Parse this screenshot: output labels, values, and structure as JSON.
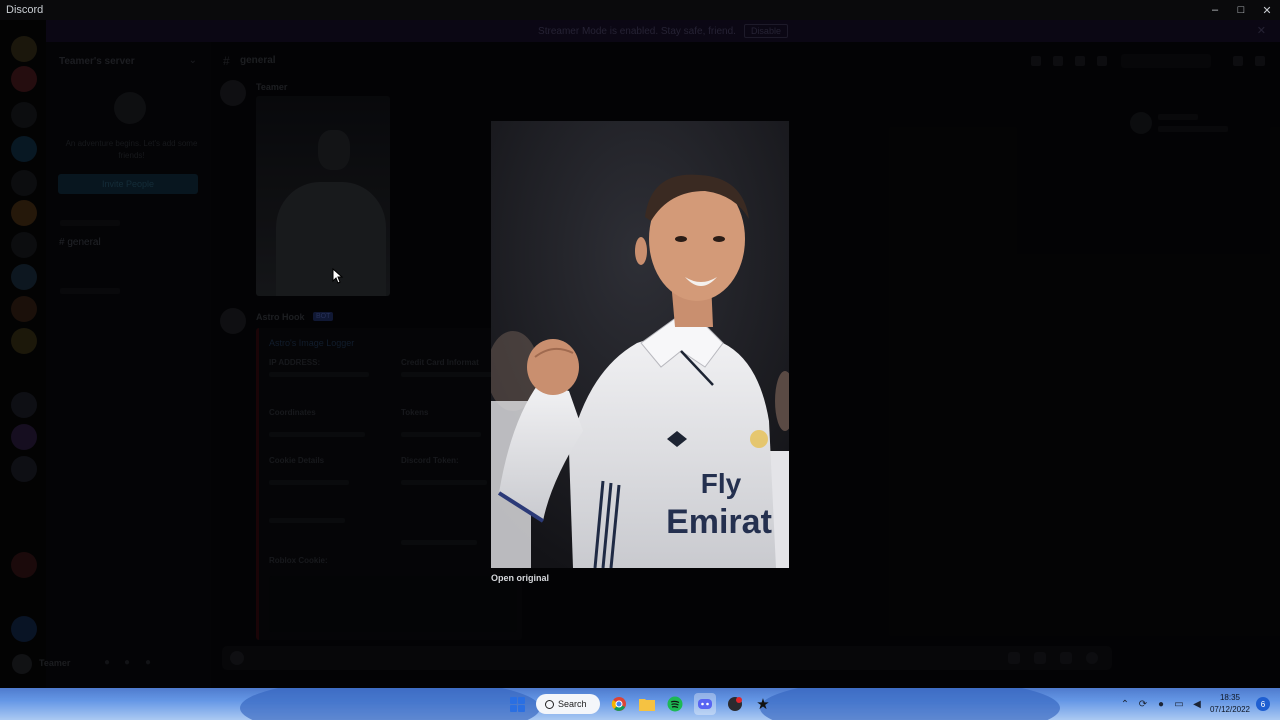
{
  "window": {
    "app_title": "Discord",
    "minimize": "–",
    "maximize": "□",
    "close": "✕"
  },
  "notice": {
    "text": "Streamer Mode is enabled. Stay safe, friend.",
    "button": "Disable"
  },
  "server": {
    "name": "Teamer's server",
    "invite_text": "An adventure begins. Let's add some friends!",
    "invite_button": "Invite People"
  },
  "channels": [
    {
      "name": "general"
    }
  ],
  "chat": {
    "channel_title": "general",
    "messages": [
      {
        "author": "Teamer",
        "has_image": true
      },
      {
        "author": "Astro Hook",
        "bot_tag": "BOT",
        "embed_title": "Astro's Image Logger"
      }
    ],
    "embed_fields": [
      "IP ADDRESS:",
      "Credit Card Informat",
      "Coordinates",
      "Tokens",
      "Cookie Details",
      "Discord Token:",
      "Roblox Cookie:"
    ]
  },
  "user": {
    "name": "Teamer"
  },
  "viewer": {
    "open_original": "Open original",
    "jersey_text": [
      "Fly",
      "Emirat"
    ]
  },
  "taskbar": {
    "search_label": "Search",
    "time": "18:35",
    "date": "07/12/2022",
    "notification_count": "6",
    "colors": {
      "accent": "#2a6fe2"
    }
  }
}
